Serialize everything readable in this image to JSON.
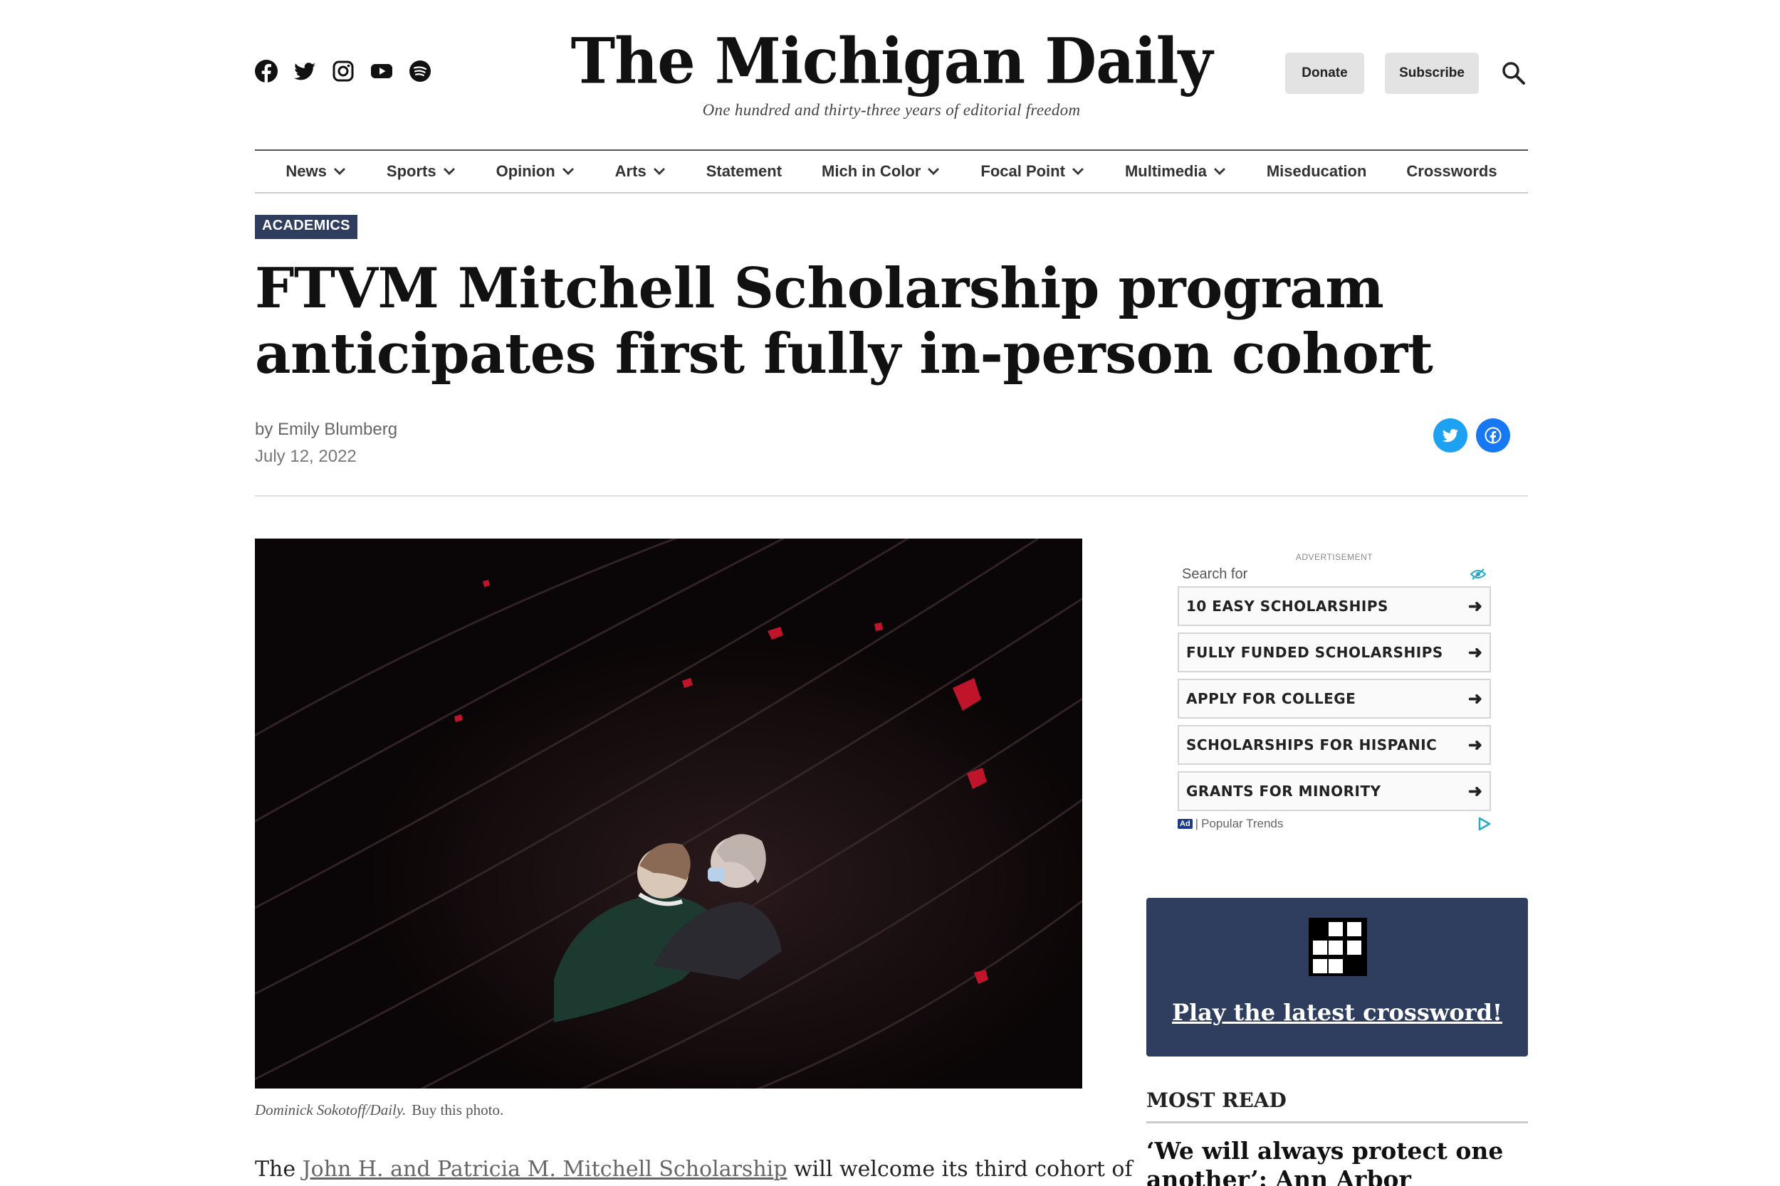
{
  "header": {
    "socials": [
      "facebook-icon",
      "twitter-icon",
      "instagram-icon",
      "youtube-icon",
      "spotify-icon"
    ],
    "logo": "The Michigan Daily",
    "tagline": "One hundred and thirty-three years of editorial freedom",
    "donate_label": "Donate",
    "subscribe_label": "Subscribe"
  },
  "nav": {
    "items": [
      {
        "label": "News",
        "dropdown": true
      },
      {
        "label": "Sports",
        "dropdown": true
      },
      {
        "label": "Opinion",
        "dropdown": true
      },
      {
        "label": "Arts",
        "dropdown": true
      },
      {
        "label": "Statement",
        "dropdown": false
      },
      {
        "label": "Mich in Color",
        "dropdown": true
      },
      {
        "label": "Focal Point",
        "dropdown": true
      },
      {
        "label": "Multimedia",
        "dropdown": true
      },
      {
        "label": "Miseducation",
        "dropdown": false
      },
      {
        "label": "Crosswords",
        "dropdown": false
      }
    ]
  },
  "article": {
    "category": "ACADEMICS",
    "headline": "FTVM Mitchell Scholarship program anticipates first fully in-person cohort",
    "byline_prefix": "by ",
    "author": "Emily Blumberg",
    "date": "July 12, 2022",
    "photo_credit": "Dominick Sokotoff/Daily.",
    "buy_photo": "Buy this photo.",
    "body_start": "The ",
    "body_link": "John H. and Patricia M. Mitchell Scholarship",
    "body_rest": " will welcome its third cohort of"
  },
  "ad": {
    "label": "ADVERTISEMENT",
    "search_for": "Search for",
    "rows": [
      "10 EASY SCHOLARSHIPS",
      "FULLY FUNDED SCHOLARSHIPS",
      "APPLY FOR COLLEGE",
      "SCHOLARSHIPS FOR HISPANIC",
      "GRANTS FOR MINORITY"
    ],
    "arrow": "➜",
    "badge": "Ad",
    "footer": "Popular Trends"
  },
  "crossword": {
    "link": "Play the latest crossword!"
  },
  "most_read": {
    "title": "MOST READ",
    "first_item": "‘We will always protect one another’: Ann Arbor community"
  },
  "colors": {
    "navy": "#2f3d5f",
    "twitter": "#1da1f2",
    "facebook": "#1877f2"
  }
}
